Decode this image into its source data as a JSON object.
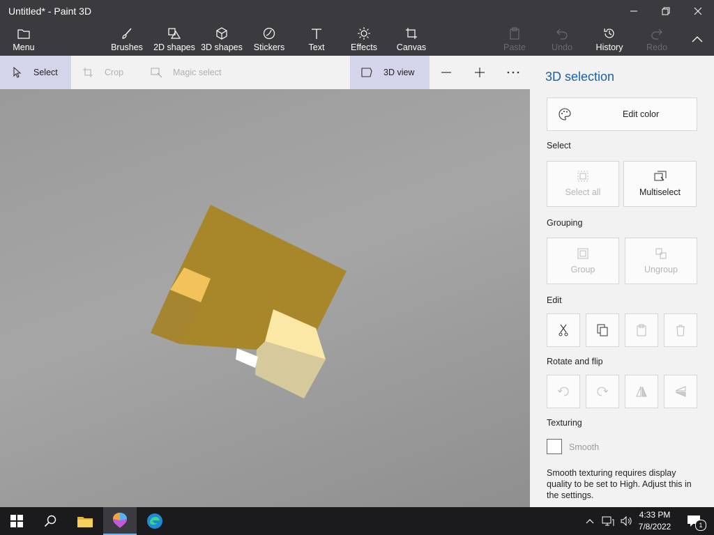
{
  "window": {
    "title": "Untitled* - Paint 3D"
  },
  "toolbar": {
    "menu": "Menu",
    "brushes": "Brushes",
    "shapes2d": "2D shapes",
    "shapes3d": "3D shapes",
    "stickers": "Stickers",
    "text": "Text",
    "effects": "Effects",
    "canvas": "Canvas",
    "paste": "Paste",
    "undo": "Undo",
    "history": "History",
    "redo": "Redo"
  },
  "subbar": {
    "select": "Select",
    "crop": "Crop",
    "magic_select": "Magic select",
    "view3d": "3D view"
  },
  "panel": {
    "title": "3D selection",
    "edit_color": "Edit color",
    "select_section": "Select",
    "select_all": "Select all",
    "multiselect": "Multiselect",
    "grouping_section": "Grouping",
    "group": "Group",
    "ungroup": "Ungroup",
    "edit_section": "Edit",
    "rotate_section": "Rotate and flip",
    "texturing_section": "Texturing",
    "smooth": "Smooth",
    "smooth_note": "Smooth texturing requires display quality to be set to High. Adjust this in the settings."
  },
  "taskbar": {
    "time": "4:33 PM",
    "date": "7/8/2022",
    "notifications": "1"
  },
  "colors": {
    "accent": "#1f5fa8",
    "chrome": "#3a3a3f",
    "taskbar": "#1b1b1e",
    "object": "#a8872a"
  }
}
